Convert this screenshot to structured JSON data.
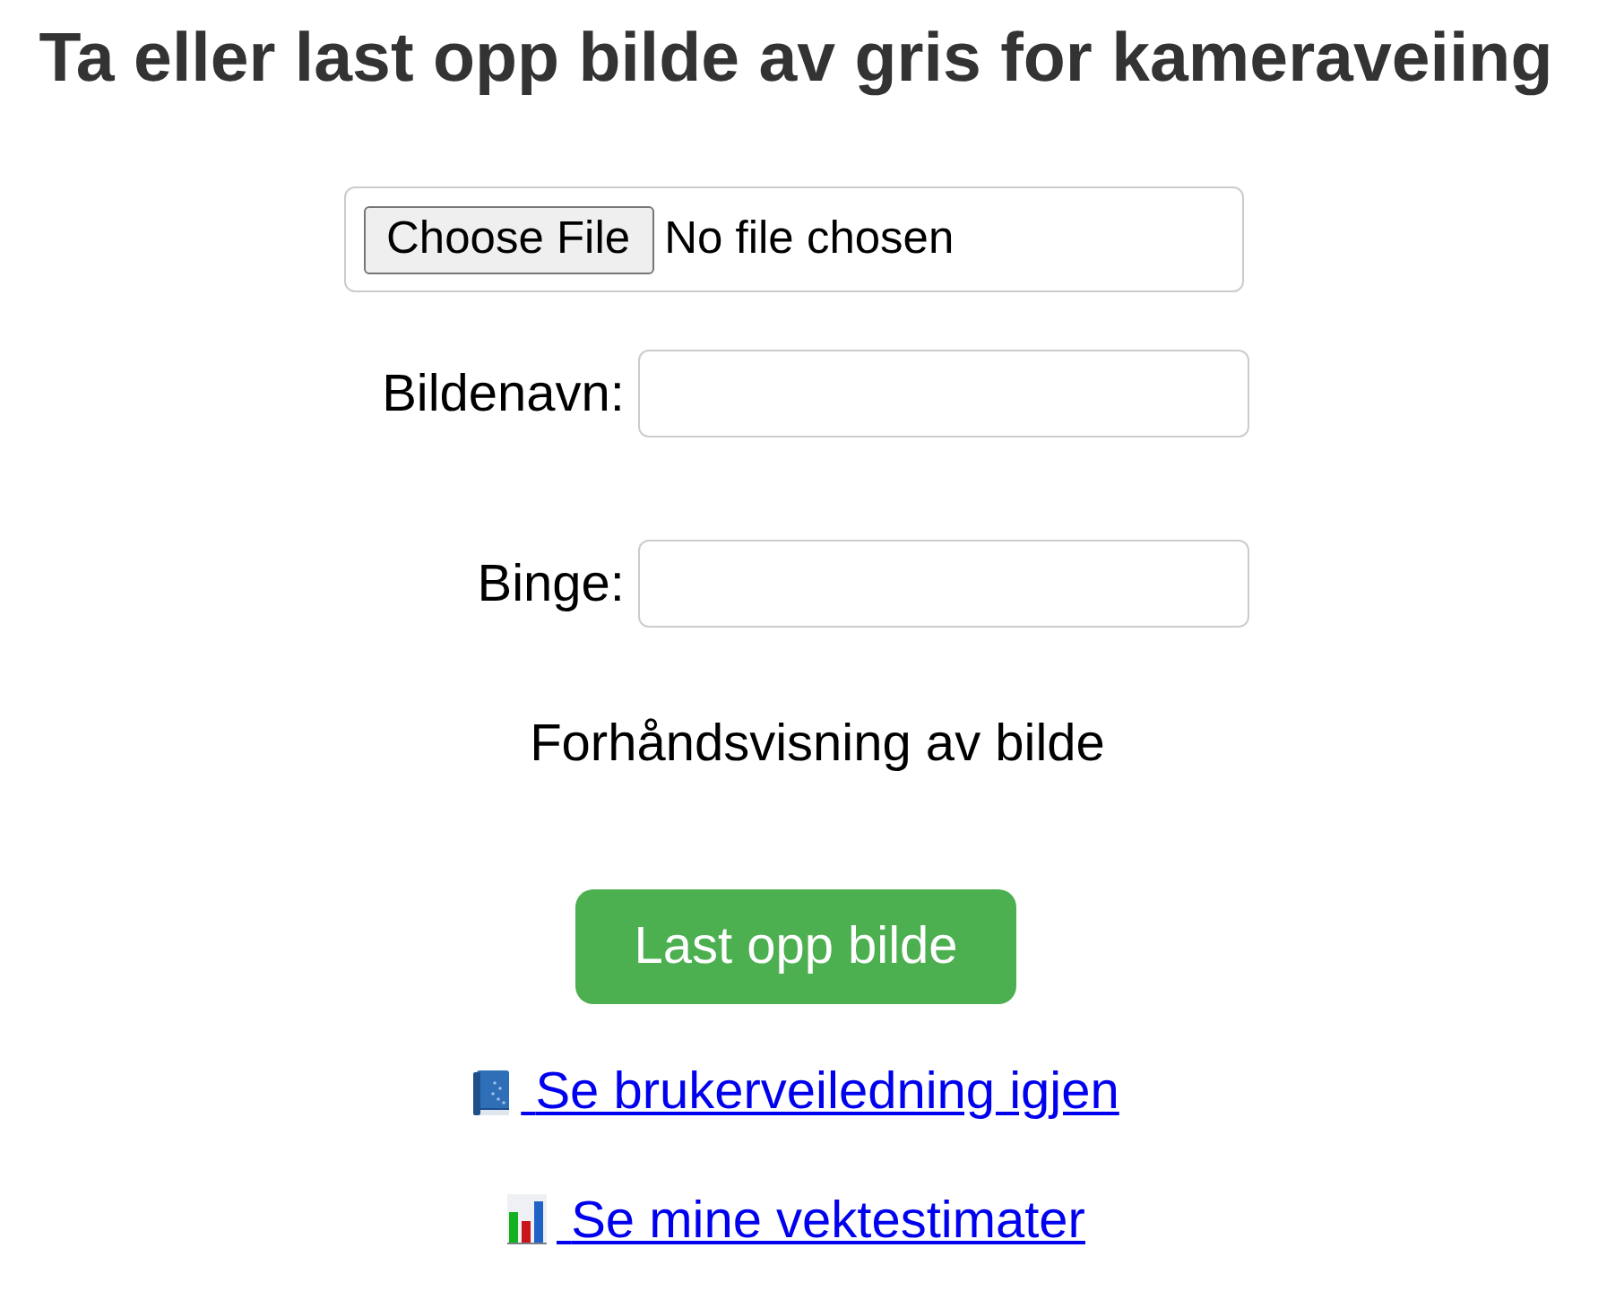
{
  "title": "Ta eller last opp bilde av gris for kameraveiing",
  "file_picker": {
    "button": "Choose File",
    "status": "No file chosen"
  },
  "fields": [
    {
      "label": "Bildenavn:"
    },
    {
      "label": "Binge:"
    }
  ],
  "preview": {
    "label": "Forhåndsvisning av bilde"
  },
  "upload_button": "Last opp bilde",
  "links": [
    {
      "label": "Se brukerveiledning igjen"
    },
    {
      "label": "Se mine vektestimater"
    }
  ]
}
